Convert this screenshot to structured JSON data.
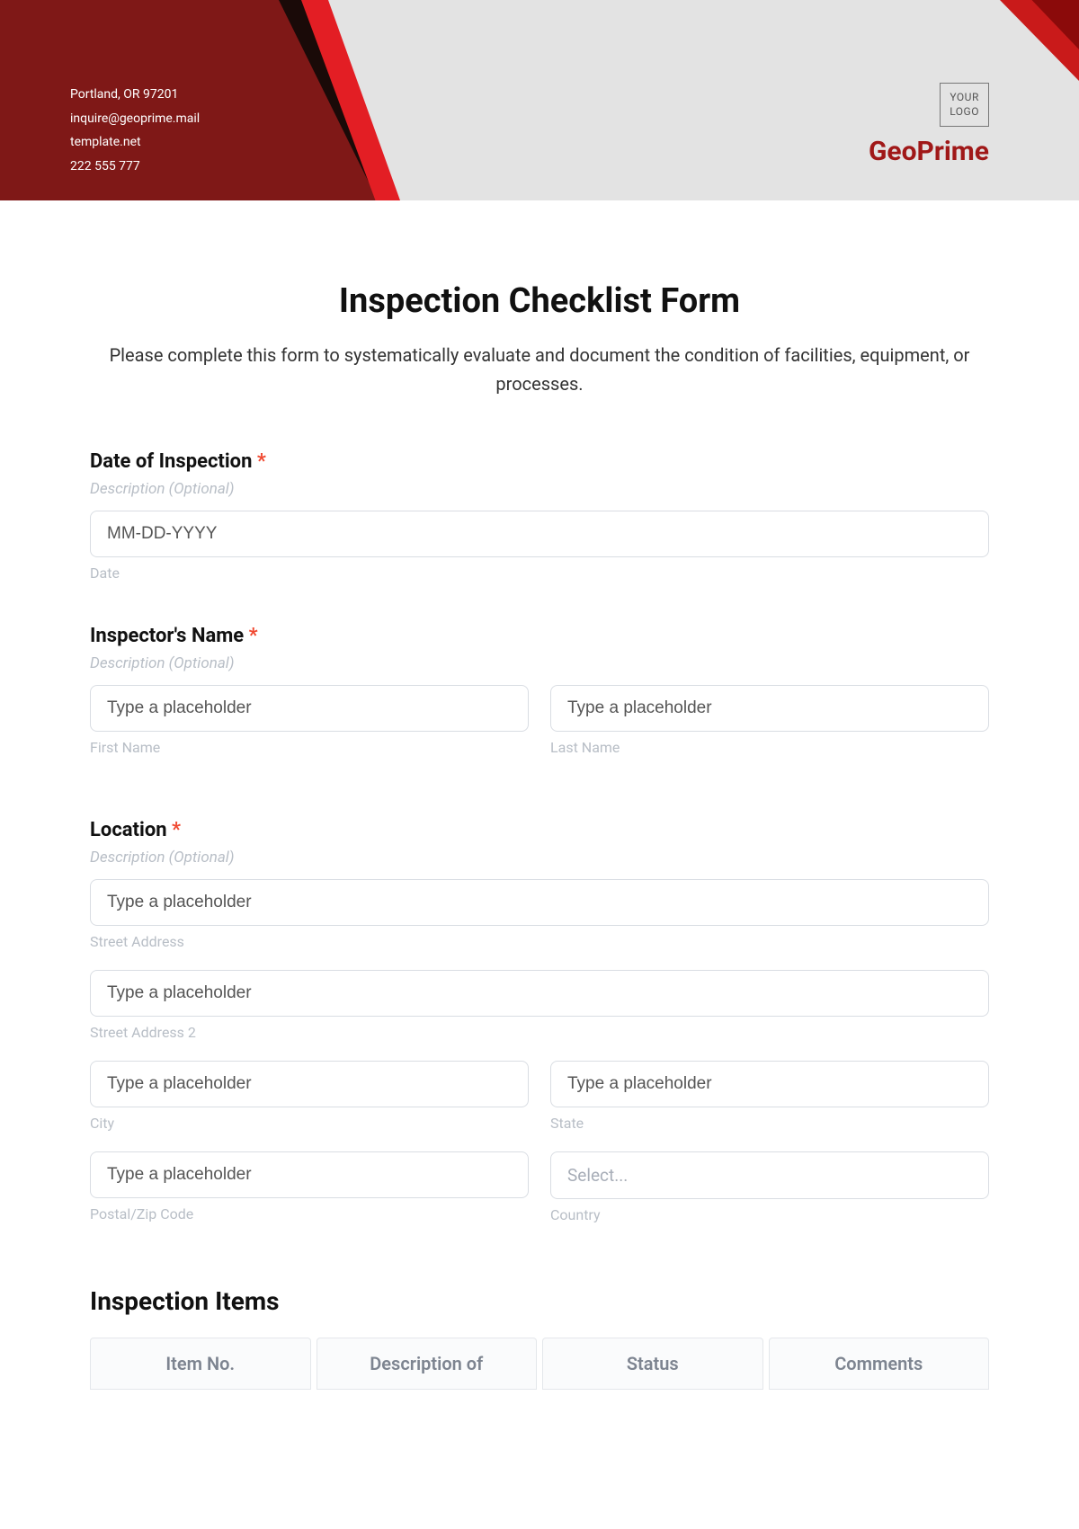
{
  "header": {
    "address": "Portland, OR 97201",
    "email": "inquire@geoprime.mail",
    "website": "template.net",
    "phone": "222 555 777",
    "logo_text": "YOUR\nLOGO",
    "brand": "GeoPrime"
  },
  "form": {
    "title": "Inspection Checklist Form",
    "subtitle": "Please complete this form to systematically evaluate and document the condition of facilities, equipment, or processes.",
    "desc_optional": "Description (Optional)",
    "placeholder_text": "Type a placeholder",
    "select_placeholder": "Select...",
    "date": {
      "label": "Date of Inspection",
      "placeholder": "MM-DD-YYYY",
      "sublabel": "Date"
    },
    "inspector": {
      "label": "Inspector's Name",
      "first_sub": "First Name",
      "last_sub": "Last Name"
    },
    "location": {
      "label": "Location",
      "street_sub": "Street Address",
      "street2_sub": "Street Address 2",
      "city_sub": "City",
      "state_sub": "State",
      "postal_sub": "Postal/Zip Code",
      "country_sub": "Country"
    },
    "items_section": "Inspection Items",
    "table": {
      "col1": "Item No.",
      "col2": "Description of",
      "col3": "Status",
      "col4": "Comments"
    }
  }
}
